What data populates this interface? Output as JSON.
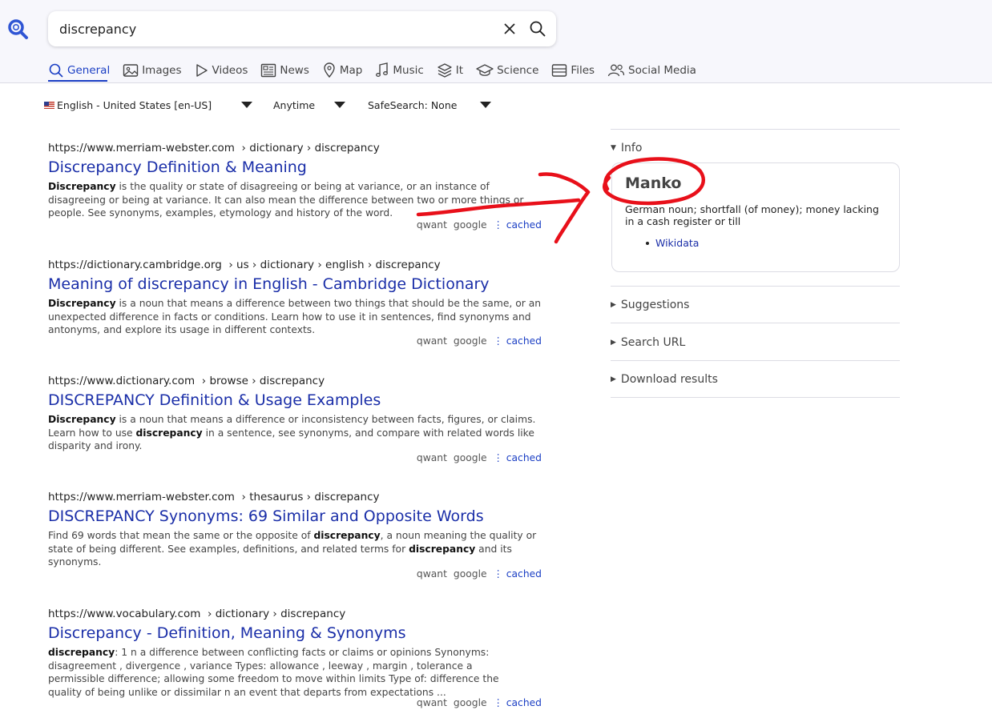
{
  "search": {
    "query": "discrepancy",
    "placeholder": ""
  },
  "tabs": [
    {
      "label": "General",
      "icon": "search-icon",
      "active": true
    },
    {
      "label": "Images",
      "icon": "image-icon"
    },
    {
      "label": "Videos",
      "icon": "play-icon"
    },
    {
      "label": "News",
      "icon": "newspaper-icon"
    },
    {
      "label": "Map",
      "icon": "map-pin-icon"
    },
    {
      "label": "Music",
      "icon": "music-note-icon"
    },
    {
      "label": "It",
      "icon": "layers-icon"
    },
    {
      "label": "Science",
      "icon": "graduation-cap-icon"
    },
    {
      "label": "Files",
      "icon": "file-box-icon"
    },
    {
      "label": "Social Media",
      "icon": "people-icon"
    }
  ],
  "filters": {
    "language": "English - United States [en-US]",
    "time": "Anytime",
    "safesearch": "SafeSearch: None"
  },
  "results": [
    {
      "url_host": "https://www.merriam-webster.com",
      "url_path": "› dictionary › discrepancy",
      "title": "Discrepancy Definition & Meaning",
      "snippet_bold": "Discrepancy",
      "snippet_rest": " is the quality or state of disagreeing or being at variance, or an instance of disagreeing or being at variance. It can also mean the difference between two or more things or people. See synonyms, examples, etymology and history of the word.",
      "engine1": "qwant",
      "engine2": "google",
      "cached": "cached"
    },
    {
      "url_host": "https://dictionary.cambridge.org",
      "url_path": "› us › dictionary › english › discrepancy",
      "title": "Meaning of discrepancy in English - Cambridge Dictionary",
      "snippet_bold": "Discrepancy",
      "snippet_rest": " is a noun that means a difference between two things that should be the same, or an unexpected difference in facts or conditions. Learn how to use it in sentences, find synonyms and antonyms, and explore its usage in different contexts.",
      "engine1": "qwant",
      "engine2": "google",
      "cached": "cached"
    },
    {
      "url_host": "https://www.dictionary.com",
      "url_path": "› browse › discrepancy",
      "title": "DISCREPANCY Definition & Usage Examples",
      "snippet_bold": "Discrepancy",
      "snippet_mid": " is a noun that means a difference or inconsistency between facts, figures, or claims. Learn how to use ",
      "snippet_bold2": "discrepancy",
      "snippet_rest": " in a sentence, see synonyms, and compare with related words like disparity and irony.",
      "engine1": "qwant",
      "engine2": "google",
      "cached": "cached"
    },
    {
      "url_host": "https://www.merriam-webster.com",
      "url_path": "› thesaurus › discrepancy",
      "title": "DISCREPANCY Synonyms: 69 Similar and Opposite Words",
      "snippet_pre": "Find 69 words that mean the same or the opposite of ",
      "snippet_bold": "discrepancy",
      "snippet_mid": ", a noun meaning the quality or state of being different. See examples, definitions, and related terms for ",
      "snippet_bold2": "discrepancy",
      "snippet_rest": " and its synonyms.",
      "engine1": "qwant",
      "engine2": "google",
      "cached": "cached"
    },
    {
      "url_host": "https://www.vocabulary.com",
      "url_path": "› dictionary › discrepancy",
      "title": "Discrepancy - Definition, Meaning & Synonyms",
      "snippet_bold": "discrepancy",
      "snippet_rest": ": 1 n a difference between conflicting facts or claims or opinions Synonyms: disagreement , divergence , variance Types: allowance , leeway , margin , tolerance a permissible difference; allowing some freedom to move within limits Type of: difference the quality of being unlike or dissimilar n an event that departs from expectations ...",
      "engine1": "qwant",
      "engine2": "google",
      "cached": "cached"
    }
  ],
  "sidebar": {
    "info_label": "Info",
    "infobox": {
      "title": "Manko",
      "description": "German noun; shortfall (of money); money lacking in a cash register or till",
      "link": "Wikidata"
    },
    "suggestions": "Suggestions",
    "search_url": "Search URL",
    "download": "Download results"
  },
  "colors": {
    "accent": "#1a3ec4",
    "link": "#1a2ea8",
    "annotation": "#e8101a"
  }
}
